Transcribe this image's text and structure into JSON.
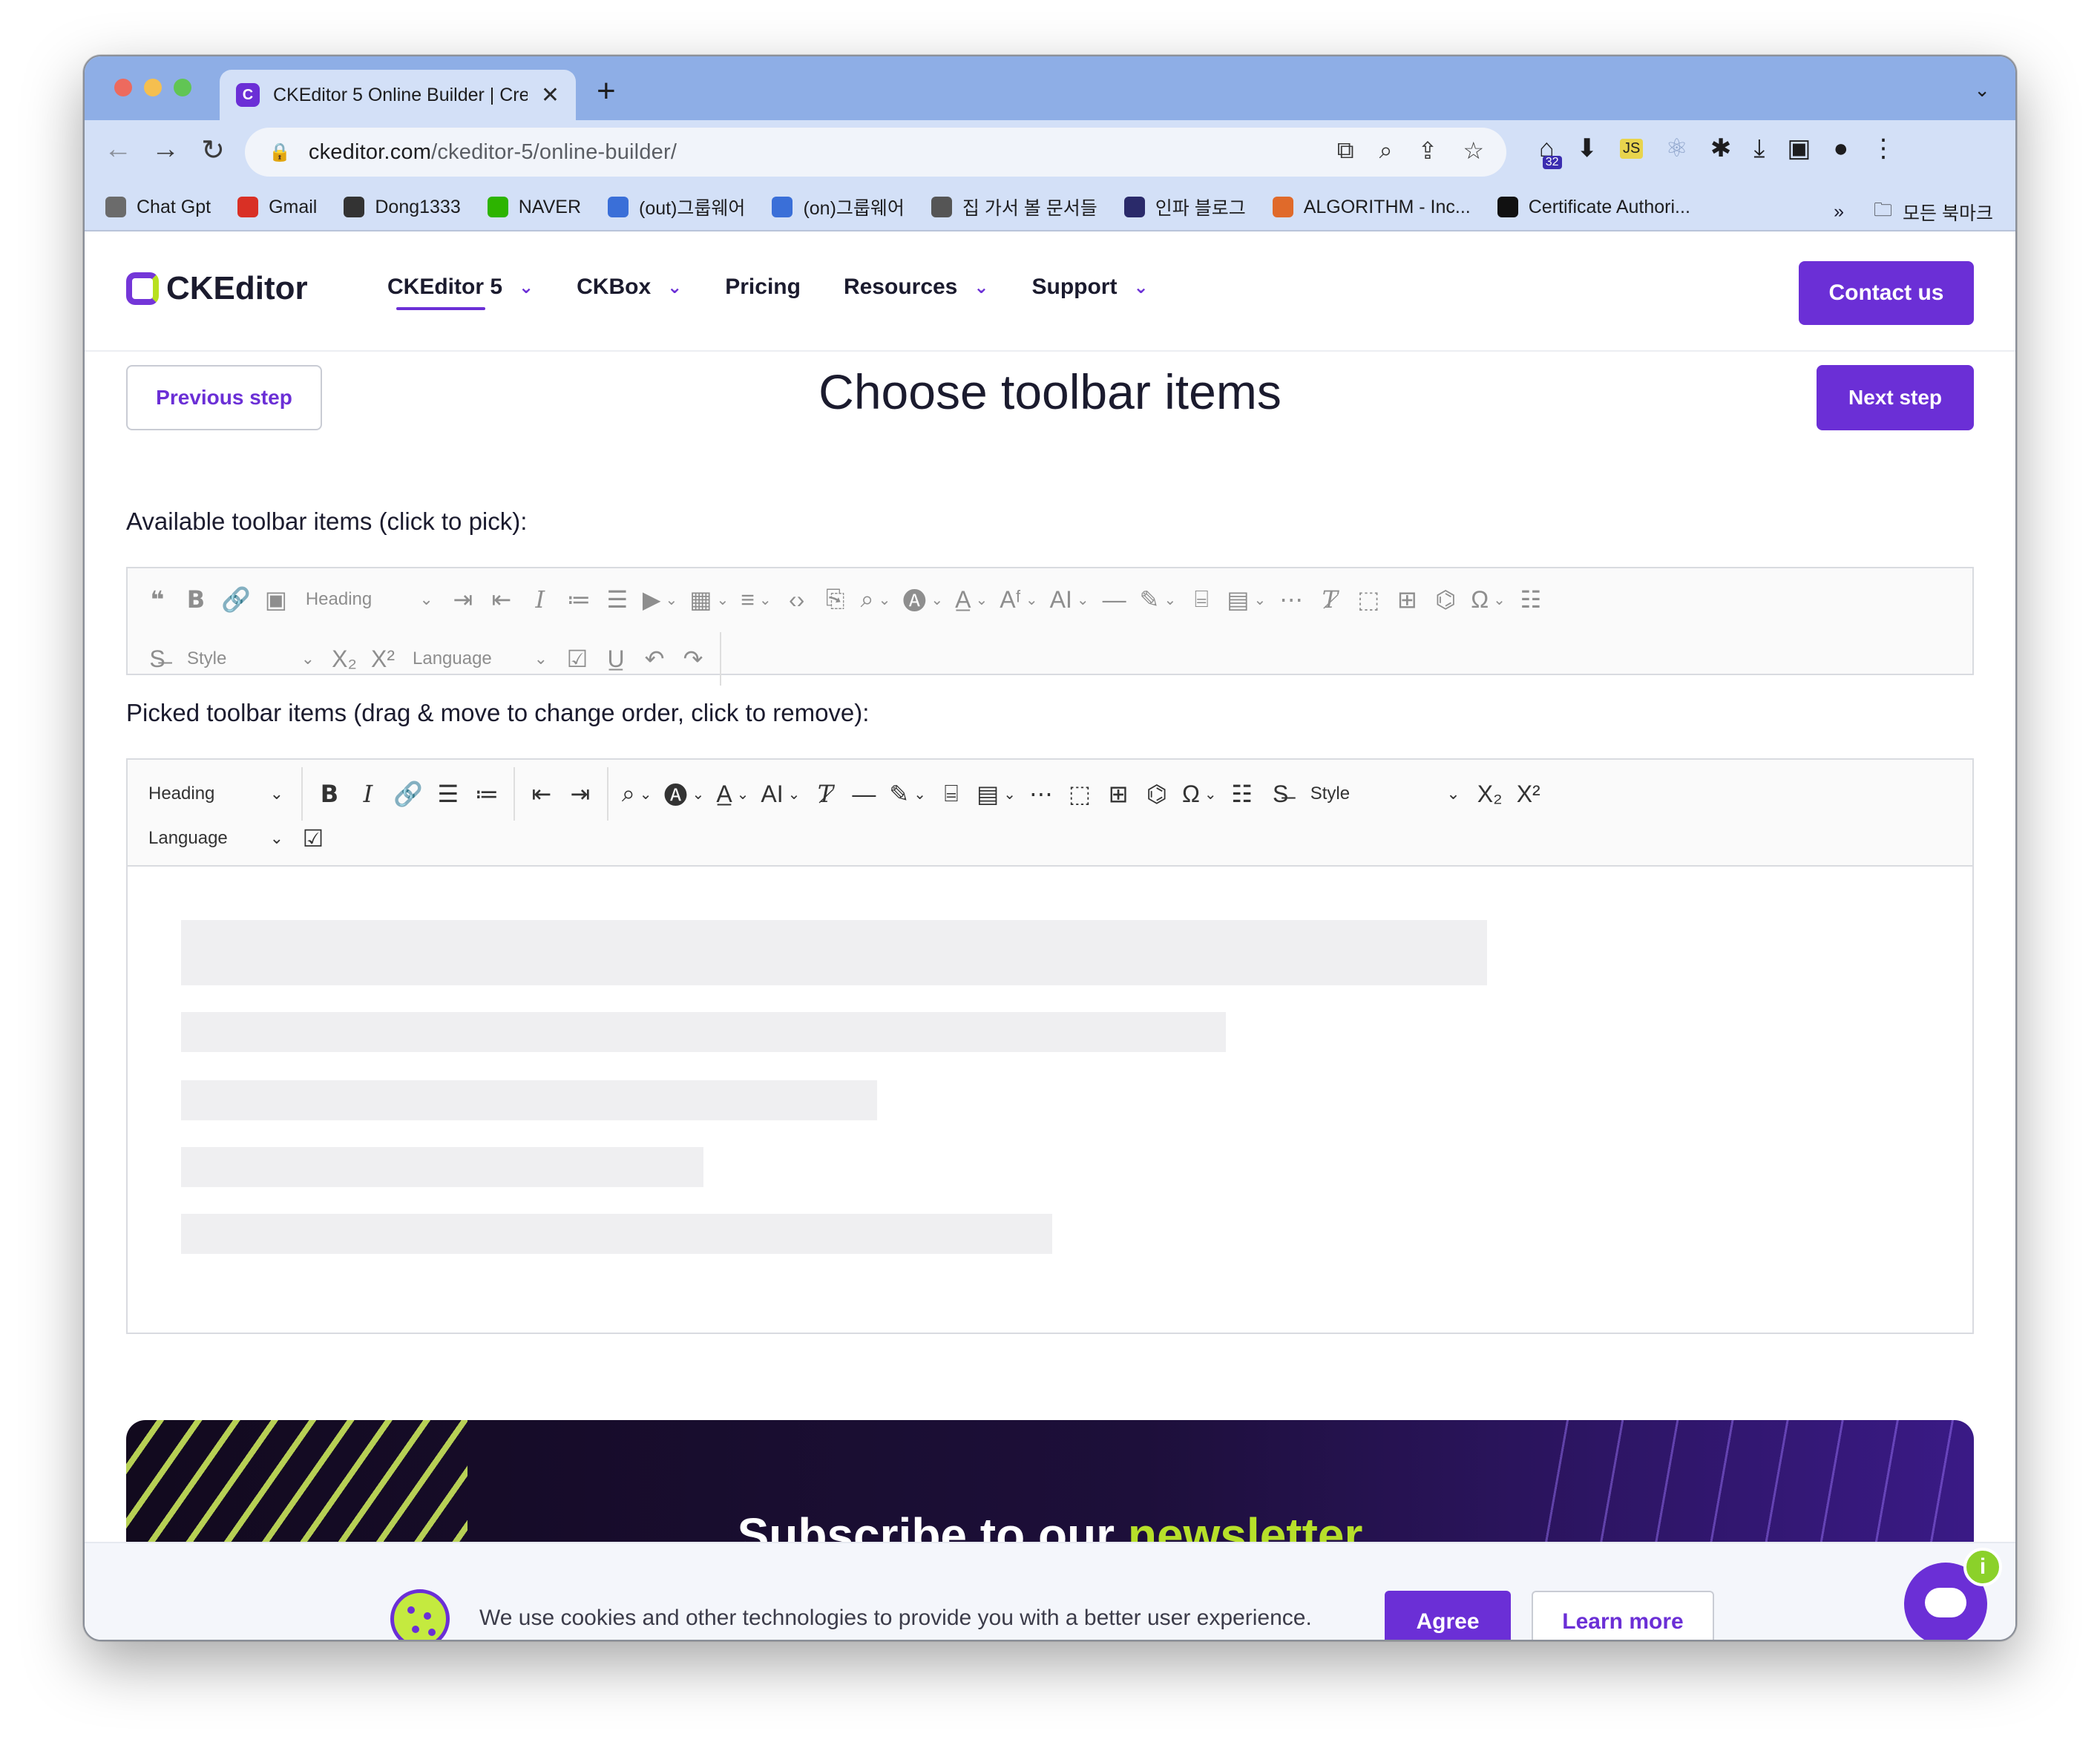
{
  "browser": {
    "tab_title": "CKEditor 5 Online Builder | Cre",
    "tab_favicon": "ckeditor-icon",
    "url_host": "ckeditor.com",
    "url_path": "/ckeditor-5/online-builder/",
    "extension_badge": "32",
    "bookmarks": [
      {
        "label": "Chat Gpt",
        "icon": "openai-icon",
        "color": "#6b6b6b"
      },
      {
        "label": "Gmail",
        "icon": "gmail-icon",
        "color": "#d93025"
      },
      {
        "label": "Dong1333",
        "icon": "github-icon",
        "color": "#333333"
      },
      {
        "label": "NAVER",
        "icon": "naver-icon",
        "color": "#2db400"
      },
      {
        "label": "(out)그룹웨어",
        "icon": "cloud-icon",
        "color": "#3a6fd8"
      },
      {
        "label": "(on)그룹웨어",
        "icon": "cloud-icon",
        "color": "#3a6fd8"
      },
      {
        "label": "집 가서 볼 문서들",
        "icon": "folder-icon",
        "color": "#555555"
      },
      {
        "label": "인파 블로그",
        "icon": "blog-icon",
        "color": "#2a2a6a"
      },
      {
        "label": "ALGORITHM - Inc...",
        "icon": "rocket-icon",
        "color": "#e06a2a"
      },
      {
        "label": "Certificate Authori...",
        "icon": "cert-icon",
        "color": "#111111"
      }
    ],
    "bookmarks_more": "»",
    "all_bookmarks": "모든 북마크"
  },
  "nav": {
    "logo": "CKEditor",
    "items": [
      {
        "label": "CKEditor 5",
        "dropdown": true,
        "active": true
      },
      {
        "label": "CKBox",
        "dropdown": true,
        "active": false
      },
      {
        "label": "Pricing",
        "dropdown": false,
        "active": false
      },
      {
        "label": "Resources",
        "dropdown": true,
        "active": false
      },
      {
        "label": "Support",
        "dropdown": true,
        "active": false
      }
    ],
    "contact": "Contact us"
  },
  "builder": {
    "title": "Choose toolbar items",
    "prev": "Previous step",
    "next": "Next step",
    "available_label": "Available toolbar items (click to pick):",
    "picked_label": "Picked toolbar items (drag & move to change order, click to remove):",
    "heading_select": "Heading",
    "style_select": "Style",
    "language_select": "Language"
  },
  "newsletter": {
    "title_prefix": "Subscribe to our",
    "title_highlight": "newsletter"
  },
  "cookie": {
    "text": "We use cookies and other technologies to provide you with a better user experience.",
    "agree": "Agree",
    "learn_more": "Learn more"
  },
  "chat": {
    "info_badge": "i"
  },
  "colors": {
    "brand": "#6b2fd6",
    "accent": "#b7e02a",
    "chrome_tab": "#8eaee6",
    "chrome_toolbar": "#d3e0f7"
  }
}
